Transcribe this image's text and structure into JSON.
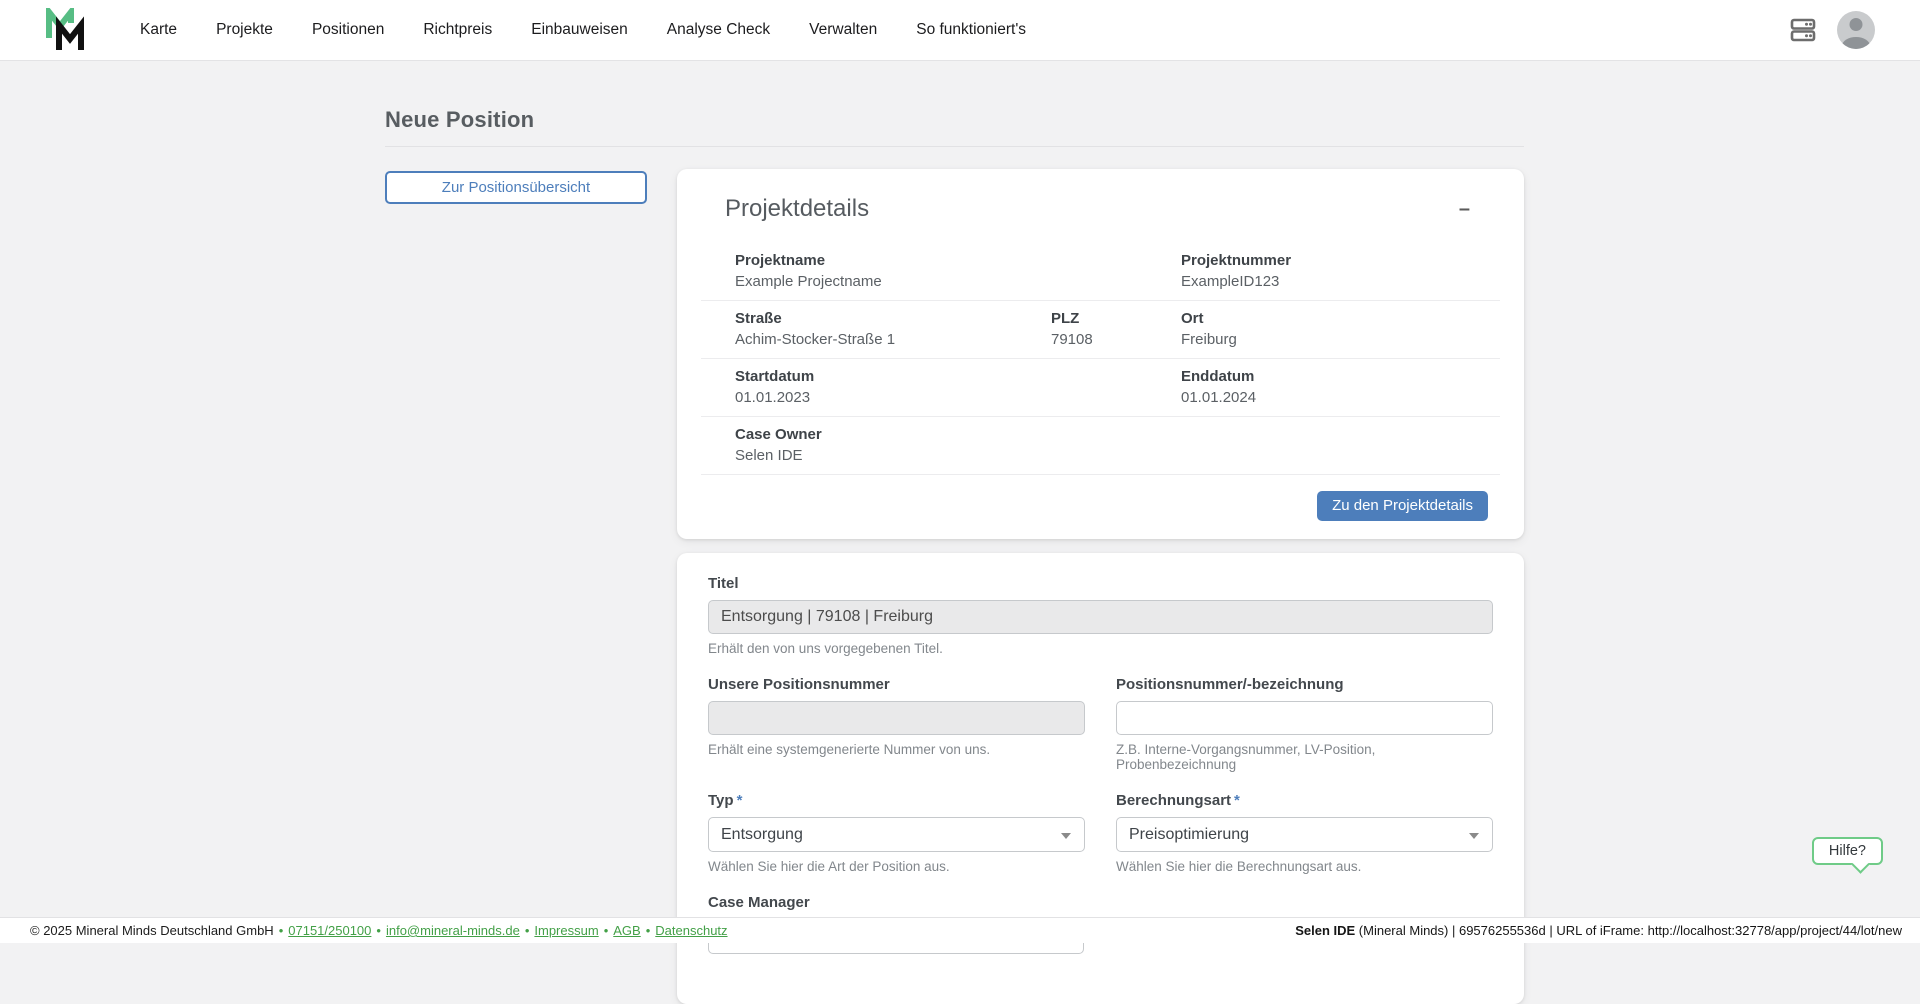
{
  "colors": {
    "accent_blue": "#4d7ebb",
    "link_green": "#43a047",
    "help_green": "#6fcb87",
    "logo_green": "#57bd84",
    "logo_black": "#111111",
    "page_bg": "#f2f2f3"
  },
  "header": {
    "nav": [
      {
        "label": "Karte"
      },
      {
        "label": "Projekte"
      },
      {
        "label": "Positionen"
      },
      {
        "label": "Richtpreis"
      },
      {
        "label": "Einbauweisen"
      },
      {
        "label": "Analyse Check"
      },
      {
        "label": "Verwalten"
      },
      {
        "label": "So funktioniert's"
      }
    ],
    "icons": [
      {
        "name": "server-icon"
      },
      {
        "name": "user-avatar"
      }
    ]
  },
  "page": {
    "title": "Neue Position"
  },
  "back_button": {
    "label": "Zur Positionsübersicht"
  },
  "project_card": {
    "title": "Projektdetails",
    "collapse_glyph": "–",
    "rows": [
      {
        "cells": [
          {
            "label": "Projektname",
            "value": "Example Projectname"
          },
          {
            "label": "Projektnummer",
            "value": "ExampleID123"
          }
        ]
      },
      {
        "cells": [
          {
            "label": "Straße",
            "value": "Achim-Stocker-Straße 1"
          },
          {
            "label": "PLZ",
            "value": "79108"
          },
          {
            "label": "Ort",
            "value": "Freiburg"
          }
        ]
      },
      {
        "cells": [
          {
            "label": "Startdatum",
            "value": "01.01.2023"
          },
          {
            "label": "Enddatum",
            "value": "01.01.2024"
          }
        ]
      },
      {
        "cells": [
          {
            "label": "Case Owner",
            "value": "Selen IDE"
          }
        ]
      }
    ],
    "action_button": "Zu den Projektdetails"
  },
  "form": {
    "titel": {
      "label": "Titel",
      "value": "Entsorgung | 79108 | Freiburg",
      "helper": "Erhält den von uns vorgegebenen Titel."
    },
    "unsere_positionsnummer": {
      "label": "Unsere Positionsnummer",
      "value": "",
      "helper": "Erhält eine systemgenerierte Nummer von uns."
    },
    "positionsnummer": {
      "label": "Positionsnummer/-bezeichnung",
      "value": "",
      "helper": "Z.B. Interne-Vorgangsnummer, LV-Position, Probenbezeichnung"
    },
    "typ": {
      "label": "Typ",
      "required": "*",
      "value": "Entsorgung",
      "helper": "Wählen Sie hier die Art der Position aus."
    },
    "berechnungsart": {
      "label": "Berechnungsart",
      "required": "*",
      "value": "Preisoptimierung",
      "helper": "Wählen Sie hier die Berechnungsart aus."
    },
    "case_manager": {
      "label": "Case Manager"
    }
  },
  "help_button": {
    "label": "Hilfe?"
  },
  "footer": {
    "copyright": "© 2025 Mineral Minds Deutschland GmbH",
    "separator": "•",
    "links": [
      {
        "label": "07151/250100"
      },
      {
        "label": "info@mineral-minds.de"
      },
      {
        "label": "Impressum"
      },
      {
        "label": "AGB"
      },
      {
        "label": "Datenschutz"
      }
    ],
    "user": "Selen IDE",
    "session_info": " (Mineral Minds) | 69576255536d | URL of iFrame: http://localhost:32778/app/project/44/lot/new"
  }
}
